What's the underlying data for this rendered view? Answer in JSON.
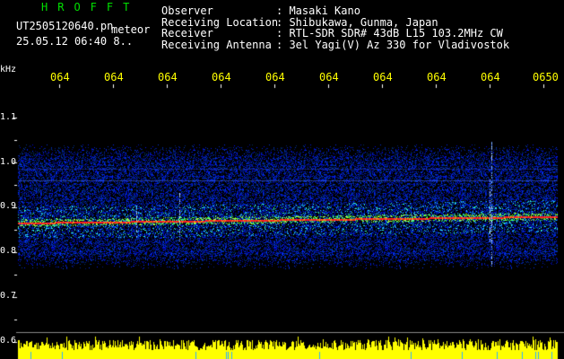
{
  "header": {
    "brand": "HROFFT",
    "filename": "UT2505120640.pn",
    "tag": "meteor",
    "timestamp": "25.05.12 06:40   8.."
  },
  "station": {
    "labels": [
      "Observer",
      "Receiving Location",
      "Receiver",
      "Receiving Antenna"
    ],
    "values": [
      ": Masaki Kano",
      ": Shibukawa, Gunma, Japan",
      ": RTL-SDR SDR# 43dB L15 103.2MHz CW",
      ": 3el Yagi(V) Az 330 for Vladivostok"
    ]
  },
  "spectrogram": {
    "unit_label": "kHz",
    "y_ticks": [
      "1.1",
      "1.0",
      "0.9",
      "0.8",
      "0.7",
      "0.6"
    ],
    "x_ticks": [
      "064",
      "064",
      "064",
      "064",
      "064",
      "064",
      "064",
      "064",
      "064",
      "0650"
    ],
    "carrier_khz": 0.87,
    "colors": {
      "background": "#000000",
      "noise": "#1530ff",
      "signal": "#ff2020",
      "level_bars": "#ffff00",
      "text": "#ffffff",
      "time_labels": "#ffff00",
      "brand": "#00e000"
    }
  }
}
